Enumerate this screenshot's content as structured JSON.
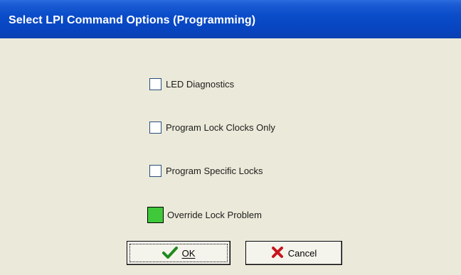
{
  "dialog": {
    "title": "Select LPI Command Options (Programming)"
  },
  "options": [
    {
      "label": "LED Diagnostics",
      "checked": false
    },
    {
      "label": "Program Lock Clocks Only",
      "checked": false
    },
    {
      "label": "Program Specific Locks",
      "checked": false
    }
  ],
  "override": {
    "label": "Override Lock Problem",
    "color": "#3ec83a"
  },
  "buttons": {
    "ok_label": "OK",
    "cancel_label": "Cancel",
    "ok_icon": "checkmark-icon",
    "cancel_icon": "x-icon"
  },
  "colors": {
    "title_bar": "#0a4cc9",
    "dialog_bg": "#ebe9d9",
    "check_green": "#1f8a1f",
    "cancel_red": "#c8141e"
  }
}
